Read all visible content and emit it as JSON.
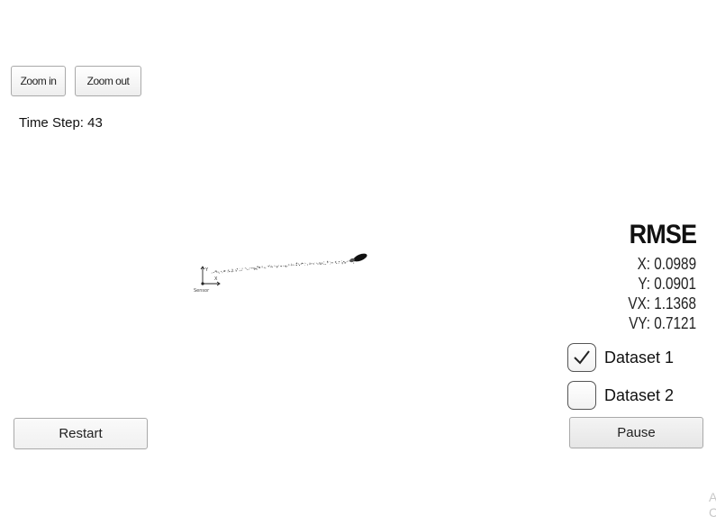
{
  "toolbar": {
    "zoom_in_label": "Zoom in",
    "zoom_out_label": "Zoom out"
  },
  "status": {
    "time_step_text": "Time Step: 43"
  },
  "visualization": {
    "sensor_label": "Sensor",
    "axis_x_label": "X",
    "axis_y_label": "Y"
  },
  "rmse": {
    "title": "RMSE",
    "x_text": "X: 0.0989",
    "y_text": "Y: 0.0901",
    "vx_text": "VX: 1.1368",
    "vy_text": "VY: 0.7121"
  },
  "datasets": [
    {
      "label": "Dataset 1",
      "checked": true
    },
    {
      "label": "Dataset 2",
      "checked": false
    }
  ],
  "controls": {
    "restart_label": "Restart",
    "pause_label": "Pause"
  },
  "corner": {
    "line1": "A",
    "line2": "C"
  }
}
